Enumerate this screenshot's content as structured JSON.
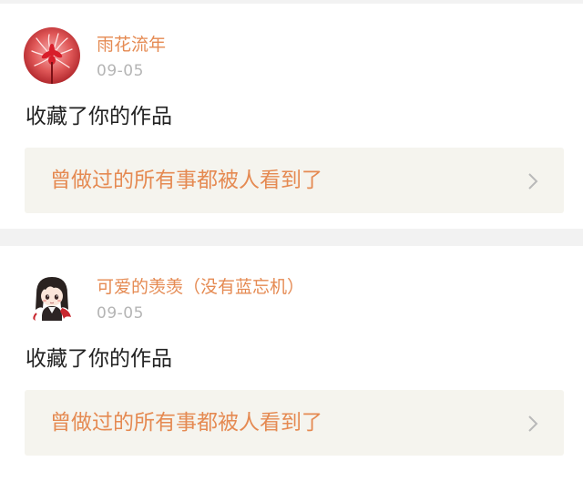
{
  "feed": [
    {
      "username": "雨花流年",
      "date": "09-05",
      "action": "收藏了你的作品",
      "work_title": "曾做过的所有事都被人看到了",
      "avatar_icon": "red-spider-lily-avatar"
    },
    {
      "username": "可爱的羡羡（没有蓝忘机）",
      "date": "09-05",
      "action": "收藏了你的作品",
      "work_title": "曾做过的所有事都被人看到了",
      "avatar_icon": "chibi-character-avatar"
    }
  ],
  "colors": {
    "accent": "#e58a52",
    "date": "#b5b5b5",
    "text": "#222222",
    "card": "#ffffff",
    "work_box": "#f5f4ee",
    "background": "#f2f2f2"
  }
}
